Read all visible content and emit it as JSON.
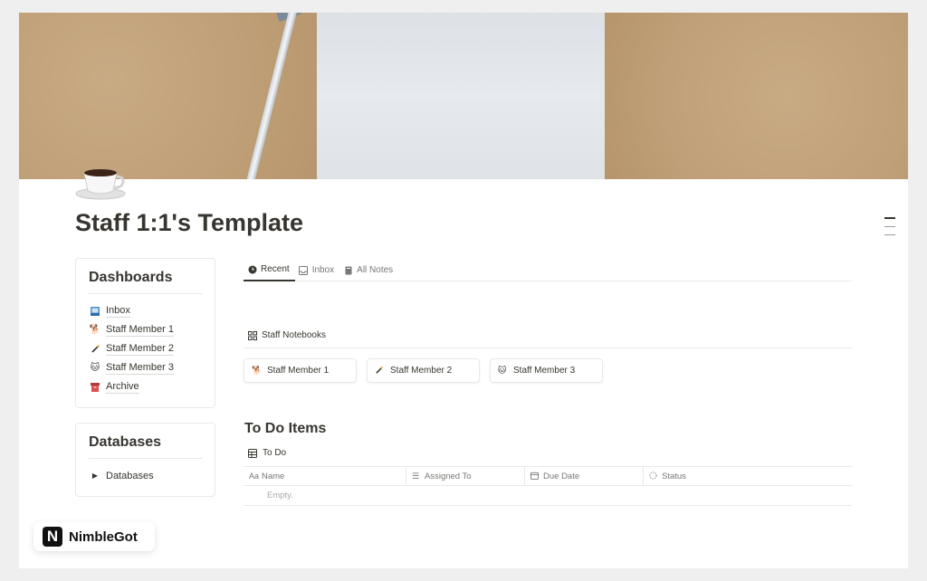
{
  "page": {
    "title": "Staff 1:1's Template"
  },
  "dashboards": {
    "heading": "Dashboards",
    "items": [
      {
        "label": "Inbox",
        "icon": "inbox-tray-icon"
      },
      {
        "label": "Staff Member 1",
        "icon": "dog-icon"
      },
      {
        "label": "Staff Member 2",
        "icon": "wand-icon"
      },
      {
        "label": "Staff Member 3",
        "icon": "cat-icon"
      },
      {
        "label": "Archive",
        "icon": "archive-box-icon"
      }
    ]
  },
  "databases": {
    "heading": "Databases",
    "items": [
      {
        "label": "Databases",
        "icon": "triangle-right-icon"
      }
    ]
  },
  "tabs": [
    {
      "label": "Recent",
      "icon": "clock-icon",
      "active": true
    },
    {
      "label": "Inbox",
      "icon": "inbox-tray-icon",
      "active": false
    },
    {
      "label": "All Notes",
      "icon": "notebook-icon",
      "active": false
    }
  ],
  "gallery": {
    "label": "Staff Notebooks",
    "icon": "gallery-grid-icon",
    "cards": [
      {
        "label": "Staff Member 1",
        "icon": "dog-icon"
      },
      {
        "label": "Staff Member 2",
        "icon": "wand-icon"
      },
      {
        "label": "Staff Member 3",
        "icon": "cat-icon"
      }
    ]
  },
  "todo": {
    "heading": "To Do Items",
    "db_label": "To Do",
    "db_icon": "table-icon",
    "columns": [
      {
        "label": "Name",
        "icon": "text-property-icon"
      },
      {
        "label": "Assigned To",
        "icon": "list-property-icon"
      },
      {
        "label": "Due Date",
        "icon": "calendar-icon"
      },
      {
        "label": "Status",
        "icon": "status-icon"
      }
    ],
    "empty_text": "Empty."
  },
  "brand": {
    "name": "NimbleGot",
    "logo_letter": "N"
  },
  "colors": {
    "text": "#37352f",
    "muted": "#787774",
    "border": "#e9e9e7",
    "cover_kraft": "#c4a47c"
  }
}
